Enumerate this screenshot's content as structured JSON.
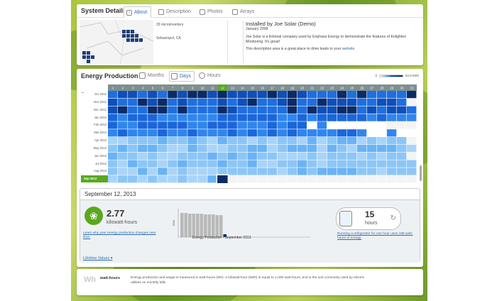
{
  "system_details": {
    "title": "System Details",
    "tabs": [
      {
        "label": "About",
        "icon": "info-icon"
      },
      {
        "label": "Description",
        "icon": "document-icon"
      },
      {
        "label": "Photos",
        "icon": "camera-icon"
      },
      {
        "label": "Arrays",
        "icon": "layers-icon"
      }
    ],
    "microinverters": "35 microinverters",
    "location": "Sebastopol, CA",
    "installer": "Installed by Joe Solar (Demo)",
    "install_date": "January 2008",
    "description": "Joe Solar is a fictional company used by Enphase Energy to demonstrate the features of Enlighten Monitoring. It's great!",
    "desc_line2_prefix": "This description area is a great place to drive leads to your ",
    "desc_link": "website",
    "desc_line2_suffix": "."
  },
  "energy_production": {
    "title": "Energy Production",
    "tabs": [
      {
        "label": "Months",
        "icon": "calendar-icon"
      },
      {
        "label": "Days",
        "icon": "calendar-icon"
      },
      {
        "label": "Hours",
        "icon": "clock-icon"
      }
    ],
    "legend_min": "0",
    "legend_max": "52.5 kWh",
    "days": [
      "1",
      "2",
      "3",
      "4",
      "5",
      "6",
      "7",
      "8",
      "9",
      "10",
      "11",
      "12",
      "13",
      "14",
      "15",
      "16",
      "17",
      "18",
      "19",
      "20",
      "21",
      "22",
      "23",
      "24",
      "25",
      "26",
      "27",
      "28",
      "29",
      "30",
      "31"
    ],
    "selected_day": "12",
    "months": [
      "Oct 2012",
      "Nov 2012",
      "Dec 2012",
      "Jan 2013",
      "Feb 2013",
      "Mar 2013",
      "Apr 2013",
      "May 2013",
      "Jun 2013",
      "Jul 2013",
      "Aug 2013",
      "Sep 2013"
    ],
    "selected_month": "Sep 2013"
  },
  "detail": {
    "date": "September 12, 2013",
    "value": "2.77",
    "unit": "kilowatt-hours",
    "learn_link": "Learn why your energy production changes over time.",
    "chart_ylabel": "kWh",
    "chart_label": "Energy Production - September 2013",
    "fridge_value": "15",
    "fridge_unit": "hours",
    "fridge_link": "Running a refrigerator for one hour uses 188 watt-hours of energy.",
    "lifetime_label": "Lifetime Values"
  },
  "footer": {
    "abbrev": "Wh",
    "title": "watt-hours",
    "text": "Energy production and usage is measured in watt-hours (Wh). A kilowatt-hour (kWh) is equal to 1,000 watt-hours, and is the unit commonly used by electric utilities on monthly bills."
  },
  "colors": {
    "accent_green": "#5aa820",
    "link_blue": "#2a6db3",
    "heat_dark": "#0b2b66",
    "heat_light": "#cfe6fb"
  }
}
